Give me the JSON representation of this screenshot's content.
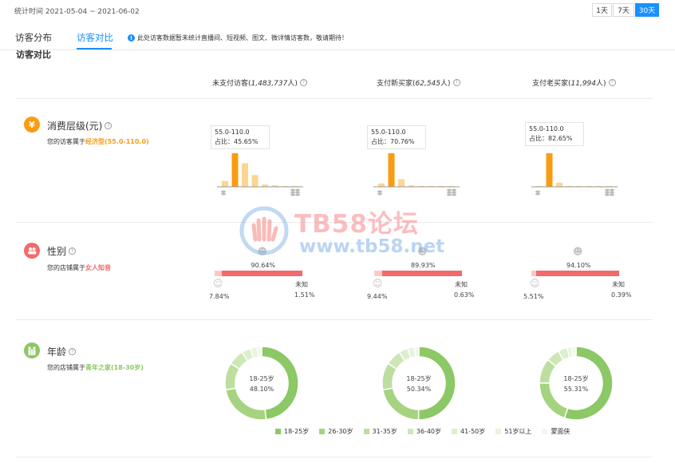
{
  "header": {
    "range_label": "统计时间 2021-05-04 ~ 2021-06-02",
    "range_buttons": [
      {
        "label": "1天",
        "active": false
      },
      {
        "label": "7天",
        "active": false
      },
      {
        "label": "30天",
        "active": true
      }
    ]
  },
  "tabs": [
    {
      "label": "访客分布",
      "active": false
    },
    {
      "label": "访客对比",
      "active": true
    }
  ],
  "notice": "此处访客数据暂未统计直播间、短视频、图文、微详情访客数，敬请期待！",
  "section_title": "访客对比",
  "columns": [
    {
      "prefix": "未支付访客(",
      "count": "1,483,737",
      "suffix": "人)"
    },
    {
      "prefix": "支付新买家(",
      "count": "62,545",
      "suffix": "人)"
    },
    {
      "prefix": "支付老买家(",
      "count": "11,994",
      "suffix": "人)"
    }
  ],
  "consumption": {
    "icon": "yen-icon",
    "color": "#fa9c11",
    "title": "消费层级(元)",
    "desc_prefix": "您的访客属于",
    "desc_highlight": "经济型(55.0-110.0)",
    "charts": [
      {
        "tip_range": "55.0-110.0",
        "tip_share": "占比：45.65%",
        "values": [
          8,
          45.65,
          32,
          16,
          3,
          2,
          1,
          1
        ]
      },
      {
        "tip_range": "55.0-110.0",
        "tip_share": "占比：70.76%",
        "values": [
          7,
          70.76,
          16,
          3,
          1,
          1,
          1,
          1
        ]
      },
      {
        "tip_range": "55.0-110.0",
        "tip_share": "占比：82.65%",
        "values": [
          2,
          82.65,
          10,
          2,
          1,
          1,
          1,
          1
        ]
      }
    ]
  },
  "gender": {
    "icon": "gender-icon",
    "color": "#f36a6a",
    "title": "性别",
    "desc_prefix": "您的店铺属于",
    "desc_highlight": "女人知音",
    "charts": [
      {
        "female_pct": "90.64%",
        "male_pct": "7.84%",
        "unknown_label": "未知",
        "unknown_pct": "1.51%",
        "female": 90.64,
        "male": 7.84,
        "unknown": 1.51
      },
      {
        "female_pct": "89.93%",
        "male_pct": "9.44%",
        "unknown_label": "未知",
        "unknown_pct": "0.63%",
        "female": 89.93,
        "male": 9.44,
        "unknown": 0.63
      },
      {
        "female_pct": "94.10%",
        "male_pct": "5.51%",
        "unknown_label": "未知",
        "unknown_pct": "0.39%",
        "female": 94.1,
        "male": 5.51,
        "unknown": 0.39
      }
    ]
  },
  "age": {
    "icon": "family-icon",
    "color": "#8cc865",
    "title": "年龄",
    "desc_prefix": "您的店铺属于",
    "desc_highlight": "青年之家(18-30岁)",
    "charts": [
      {
        "center_label": "18-25岁",
        "center_pct": "48.10%",
        "values": [
          48.1,
          24,
          12,
          7,
          4,
          3,
          2
        ]
      },
      {
        "center_label": "18-25岁",
        "center_pct": "50.34%",
        "values": [
          50.34,
          22,
          12,
          7,
          4,
          3,
          2
        ]
      },
      {
        "center_label": "18-25岁",
        "center_pct": "55.31%",
        "values": [
          55.31,
          20,
          11,
          6,
          4,
          2,
          2
        ]
      }
    ],
    "legend": [
      {
        "label": "18-25岁",
        "color": "#8cc865"
      },
      {
        "label": "26-30岁",
        "color": "#a5d37f"
      },
      {
        "label": "31-35岁",
        "color": "#bcde9f"
      },
      {
        "label": "36-40岁",
        "color": "#cde7b6"
      },
      {
        "label": "41-50岁",
        "color": "#dcefcc"
      },
      {
        "label": "51岁以上",
        "color": "#e8f4dd"
      },
      {
        "label": "蒙面侠",
        "color": "#f1f8ea"
      }
    ]
  },
  "watermark": {
    "line1": "TB58论坛",
    "line2": "www.tb58.net"
  }
}
